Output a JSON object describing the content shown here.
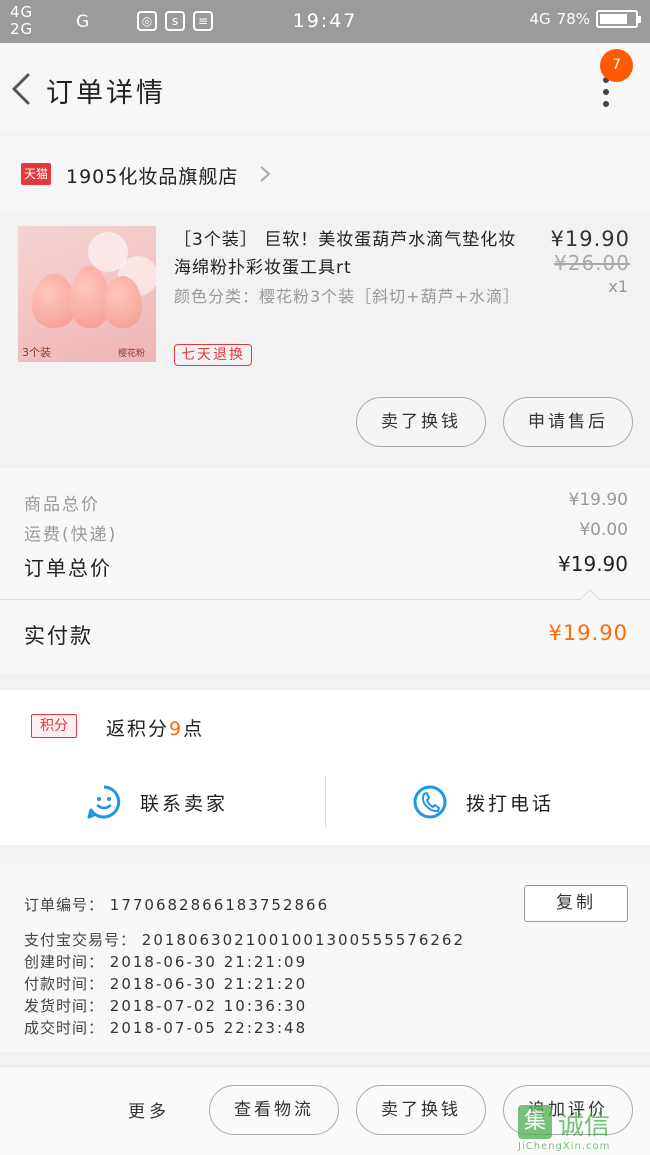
{
  "status_bar": {
    "net1": "4G",
    "net2": "2G",
    "net3": "G",
    "time": "19:47",
    "net4": "4G",
    "battery_text": "78%",
    "battery_level": 0.78
  },
  "header": {
    "title": "订单详情",
    "badge_count": "7"
  },
  "shop": {
    "logo_text": "天猫",
    "name": "1905化妆品旗舰店"
  },
  "product": {
    "title": "［3个装］ 巨软！美妆蛋葫芦水滴气垫化妆海绵粉扑彩妆蛋工具rt",
    "sku": "颜色分类：樱花粉3个装［斜切+葫芦+水滴］",
    "tag": "七天退换",
    "price": "¥19.90",
    "original_price": "¥26.00",
    "quantity": "x1",
    "image_caption_left": "3个装",
    "image_caption_right": "樱花粉",
    "buttons": {
      "sell_exchange": "卖了换钱",
      "after_sale": "申请售后"
    }
  },
  "totals": {
    "goods_label": "商品总价",
    "goods_value": "¥19.90",
    "shipping_label": "运费(快递)",
    "shipping_value": "¥0.00",
    "order_label": "订单总价",
    "order_value": "¥19.90",
    "paid_label": "实付款",
    "paid_value": "¥19.90"
  },
  "points": {
    "badge": "积分",
    "text_before": "返积分",
    "value": "9",
    "text_after": "点"
  },
  "contact": {
    "seller": "联系卖家",
    "phone": "拨打电话"
  },
  "order_info": {
    "order_no_label": "订单编号：",
    "order_no": "1770682866183752866",
    "alipay_label": "支付宝交易号：",
    "alipay_no": "2018063021001001300555576262",
    "created_label": "创建时间：",
    "created": "2018-06-30  21:21:09",
    "paid_label": "付款时间：",
    "paid": "2018-06-30  21:21:20",
    "shipped_label": "发货时间：",
    "shipped": "2018-07-02  10:36:30",
    "completed_label": "成交时间：",
    "completed": "2018-07-05  22:23:48",
    "copy_button": "复制"
  },
  "bottom_bar": {
    "more": "更多",
    "logistics": "查看物流",
    "sell_exchange": "卖了换钱",
    "review": "追加评价"
  },
  "watermark": {
    "logo": "集",
    "text": "诚信",
    "site": "JiChengXin.com"
  },
  "colors": {
    "accent_orange": "#ff6a00",
    "tmall_red": "#e4393c",
    "contact_blue": "#2196e8"
  }
}
